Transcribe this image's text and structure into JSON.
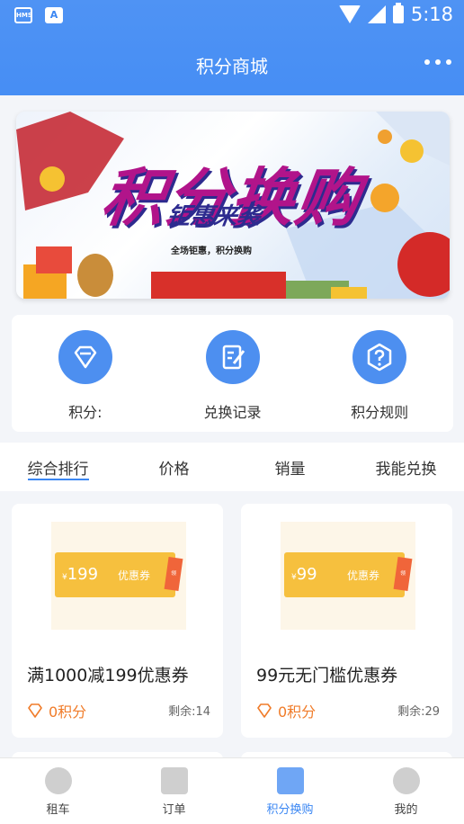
{
  "status_bar": {
    "left_icons": [
      "HMS",
      "A"
    ],
    "time": "5:18"
  },
  "header": {
    "title": "积分商城"
  },
  "banner": {
    "title": "积分换购",
    "subtitle": "钜惠来袭",
    "tagline": "全场钜惠，积分换购"
  },
  "actions": [
    {
      "label": "积分:",
      "icon": "diamond-icon"
    },
    {
      "label": "兑换记录",
      "icon": "edit-record-icon"
    },
    {
      "label": "积分规则",
      "icon": "question-shield-icon"
    }
  ],
  "sort_tabs": [
    "综合排行",
    "价格",
    "销量",
    "我能兑换"
  ],
  "products": [
    {
      "coupon_value": "199",
      "coupon_tag": "优惠券",
      "name": "满1000减199优惠券",
      "points": "0积分",
      "stock": "剩余:14"
    },
    {
      "coupon_value": "99",
      "coupon_tag": "优惠券",
      "name": "99元无门槛优惠券",
      "points": "0积分",
      "stock": "剩余:29"
    }
  ],
  "coupon_currency": "¥",
  "coupon_flag": "领",
  "bottom_nav": [
    {
      "label": "租车",
      "icon": "compass-icon"
    },
    {
      "label": "订单",
      "icon": "order-icon"
    },
    {
      "label": "积分换购",
      "icon": "shop-icon"
    },
    {
      "label": "我的",
      "icon": "user-icon"
    }
  ],
  "colors": {
    "primary": "#3b87f3",
    "accent_orange": "#f07c2a",
    "coupon_yellow": "#f6c03e"
  }
}
